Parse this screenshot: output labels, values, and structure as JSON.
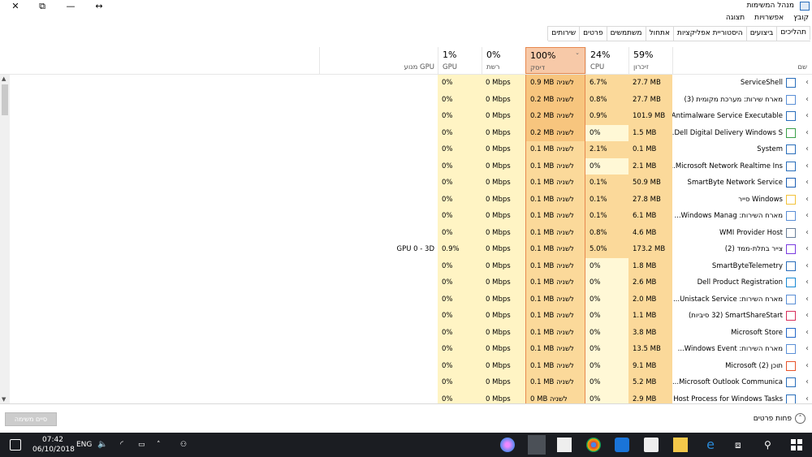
{
  "window": {
    "title": "מנהל המשימות",
    "controls": {
      "close": "✕",
      "restore": "⧉",
      "minimize": "—",
      "resize": "↔"
    }
  },
  "menu": [
    "קובץ",
    "אפשרויות",
    "תצוגה"
  ],
  "tabs": [
    "תהליכים",
    "ביצועים",
    "היסטוריית אפליקציות",
    "אתחול",
    "משתמשים",
    "פרטים",
    "שירותים"
  ],
  "columns": {
    "name": {
      "label": "שם"
    },
    "memory": {
      "pct": "59%",
      "label": "זיכרון"
    },
    "cpu": {
      "pct": "24%",
      "label": "CPU"
    },
    "disk": {
      "pct": "100%",
      "label": "דיסק"
    },
    "network": {
      "pct": "0%",
      "label": "רשת"
    },
    "gpu": {
      "pct": "1%",
      "label": "GPU"
    },
    "gpu_engine": {
      "label": "מנוע GPU"
    }
  },
  "rows": [
    {
      "name": "ServiceShell",
      "memory": "27.7 MB",
      "cpu": "6.7%",
      "disk": "0.9 MB לשניה",
      "network": "0 Mbps",
      "gpu": "0%",
      "gpu_engine": "",
      "icon": "window-icon"
    },
    {
      "name": "מארח שירות: מערכת מקומית (3)",
      "memory": "27.7 MB",
      "cpu": "0.8%",
      "disk": "0.2 MB לשניה",
      "network": "0 Mbps",
      "gpu": "0%",
      "gpu_engine": "",
      "icon": "gear-icon"
    },
    {
      "name": "Antimalware Service Executable",
      "memory": "101.9 MB",
      "cpu": "0.9%",
      "disk": "0.2 MB לשניה",
      "network": "0 Mbps",
      "gpu": "0%",
      "gpu_engine": "",
      "icon": "window-icon"
    },
    {
      "name": "Dell Digital Delivery Windows S...",
      "memory": "1.5 MB",
      "cpu": "0%",
      "disk": "0.2 MB לשניה",
      "network": "0 Mbps",
      "gpu": "0%",
      "gpu_engine": "",
      "icon": "delivery-icon"
    },
    {
      "name": "System",
      "memory": "0.1 MB",
      "cpu": "2.1%",
      "disk": "0.1 MB לשניה",
      "network": "0 Mbps",
      "gpu": "0%",
      "gpu_engine": "",
      "icon": "window-icon"
    },
    {
      "name": "Microsoft Network Realtime Ins...",
      "memory": "2.1 MB",
      "cpu": "0%",
      "disk": "0.1 MB לשניה",
      "network": "0 Mbps",
      "gpu": "0%",
      "gpu_engine": "",
      "icon": "window-icon"
    },
    {
      "name": "SmartByte Network Service",
      "memory": "50.9 MB",
      "cpu": "0.1%",
      "disk": "0.1 MB לשניה",
      "network": "0 Mbps",
      "gpu": "0%",
      "gpu_engine": "",
      "icon": "smartbyte-icon"
    },
    {
      "name": "Windows סייר",
      "memory": "27.8 MB",
      "cpu": "0.1%",
      "disk": "0.1 MB לשניה",
      "network": "0 Mbps",
      "gpu": "0%",
      "gpu_engine": "",
      "icon": "folder-icon"
    },
    {
      "name": "מארח השירות: Windows Manag...",
      "memory": "6.1 MB",
      "cpu": "0.1%",
      "disk": "0.1 MB לשניה",
      "network": "0 Mbps",
      "gpu": "0%",
      "gpu_engine": "",
      "icon": "gear-icon"
    },
    {
      "name": "WMI Provider Host",
      "memory": "4.6 MB",
      "cpu": "0.8%",
      "disk": "0.1 MB לשניה",
      "network": "0 Mbps",
      "gpu": "0%",
      "gpu_engine": "",
      "icon": "wmi-icon"
    },
    {
      "name": "צייר בתלת-ממד (2)",
      "memory": "173.2 MB",
      "cpu": "5.0%",
      "disk": "0.1 MB לשניה",
      "network": "0 Mbps",
      "gpu": "0.9%",
      "gpu_engine": "GPU 0 - 3D",
      "icon": "paint3d-icon"
    },
    {
      "name": "SmartByteTelemetry",
      "memory": "1.8 MB",
      "cpu": "0%",
      "disk": "0.1 MB לשניה",
      "network": "0 Mbps",
      "gpu": "0%",
      "gpu_engine": "",
      "icon": "window-icon"
    },
    {
      "name": "Dell Product Registration",
      "memory": "2.6 MB",
      "cpu": "0%",
      "disk": "0.1 MB לשניה",
      "network": "0 Mbps",
      "gpu": "0%",
      "gpu_engine": "",
      "icon": "registration-icon"
    },
    {
      "name": "מארח השירות: Unistack Service...",
      "memory": "2.0 MB",
      "cpu": "0%",
      "disk": "0.1 MB לשניה",
      "network": "0 Mbps",
      "gpu": "0%",
      "gpu_engine": "",
      "icon": "gear-icon"
    },
    {
      "name": "SmartShareStart (32 סיביות)",
      "memory": "1.1 MB",
      "cpu": "0%",
      "disk": "0.1 MB לשניה",
      "network": "0 Mbps",
      "gpu": "0%",
      "gpu_engine": "",
      "icon": "smartshare-icon"
    },
    {
      "name": "Microsoft Store",
      "memory": "3.8 MB",
      "cpu": "0%",
      "disk": "0.1 MB לשניה",
      "network": "0 Mbps",
      "gpu": "0%",
      "gpu_engine": "",
      "icon": "store-icon"
    },
    {
      "name": "מארח השירות: Windows Event...",
      "memory": "13.5 MB",
      "cpu": "0%",
      "disk": "0.1 MB לשניה",
      "network": "0 Mbps",
      "gpu": "0%",
      "gpu_engine": "",
      "icon": "gear-icon"
    },
    {
      "name": "תוכן Microsoft (2)",
      "memory": "9.1 MB",
      "cpu": "0%",
      "disk": "0.1 MB לשניה",
      "network": "0 Mbps",
      "gpu": "0%",
      "gpu_engine": "",
      "icon": "windows-logo-icon"
    },
    {
      "name": "Microsoft Outlook Communica...",
      "memory": "5.2 MB",
      "cpu": "0%",
      "disk": "0.1 MB לשניה",
      "network": "0 Mbps",
      "gpu": "0%",
      "gpu_engine": "",
      "icon": "window-icon"
    },
    {
      "name": "Host Process for Windows Tasks",
      "memory": "2.9 MB",
      "cpu": "0%",
      "disk": "0 MB לשניה",
      "network": "0 Mbps",
      "gpu": "0%",
      "gpu_engine": "",
      "icon": "window-icon"
    }
  ],
  "footer": {
    "end_task": "סיים משימה",
    "fewer_details": "פחות פרטים"
  },
  "taskbar": {
    "time": "07:42",
    "date": "06/10/2018",
    "language": "ENG"
  },
  "colors": {
    "disk_heavy": "#f7c57e",
    "disk_medium": "#fbd99a",
    "light": "#fff4c4",
    "lighter": "#fff8d6",
    "selected_header": "#f7c9a8"
  }
}
